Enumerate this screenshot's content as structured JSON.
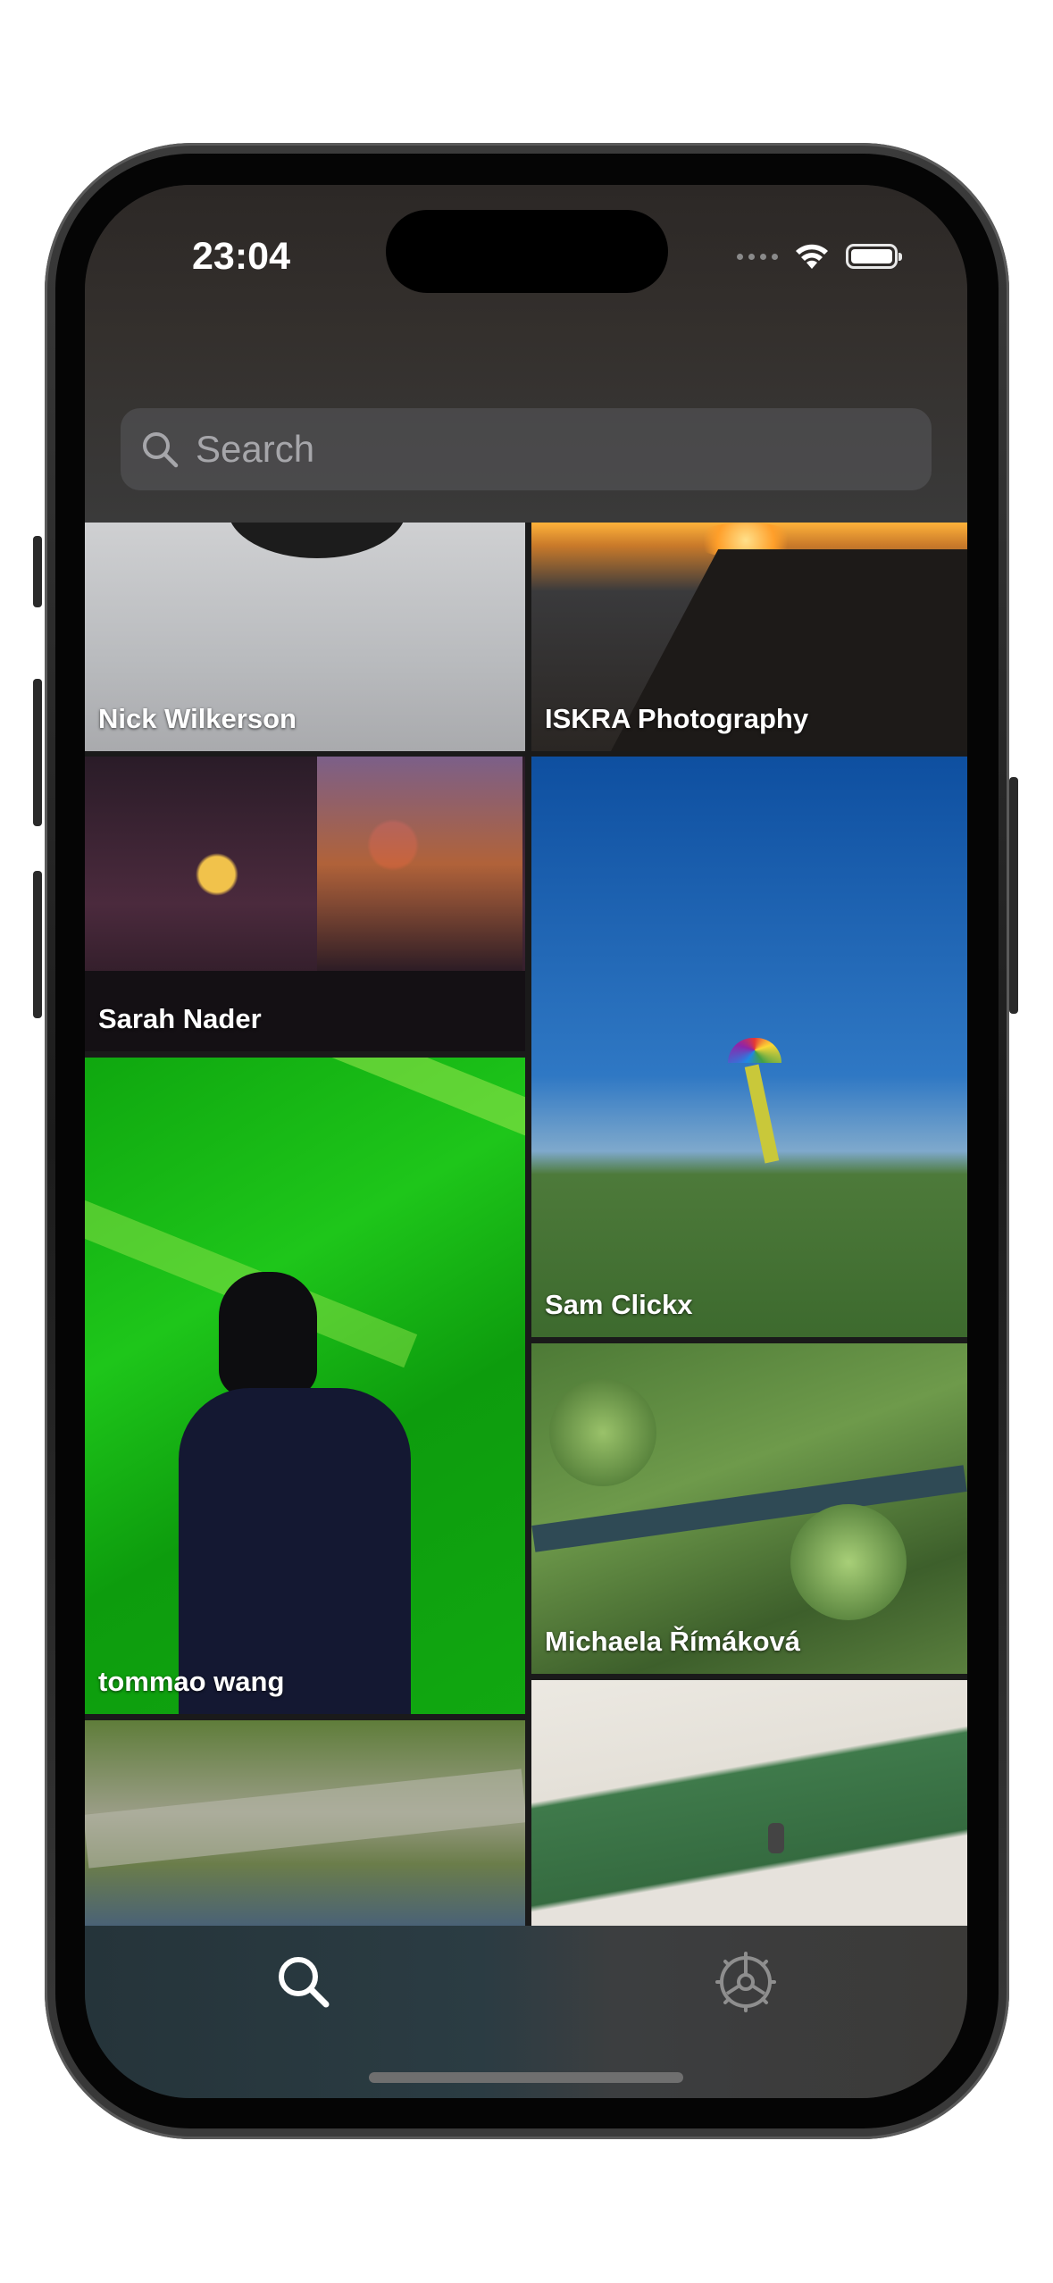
{
  "status_bar": {
    "time": "23:04"
  },
  "search": {
    "placeholder": "Search"
  },
  "photos": [
    {
      "author": "Nick Wilkerson"
    },
    {
      "author": "ISKRA Photography"
    },
    {
      "author": "Sarah Nader"
    },
    {
      "author": "Sam Clickx"
    },
    {
      "author": "tommao wang"
    },
    {
      "author": "Michaela Římáková"
    },
    {
      "author": ""
    },
    {
      "author": ""
    }
  ],
  "tab_bar": {
    "items": [
      {
        "icon": "search-icon",
        "selected": true
      },
      {
        "icon": "gear-icon",
        "selected": false
      }
    ]
  },
  "colors": {
    "accent": "#ffffff",
    "tab_inactive": "#8e8e8e"
  }
}
